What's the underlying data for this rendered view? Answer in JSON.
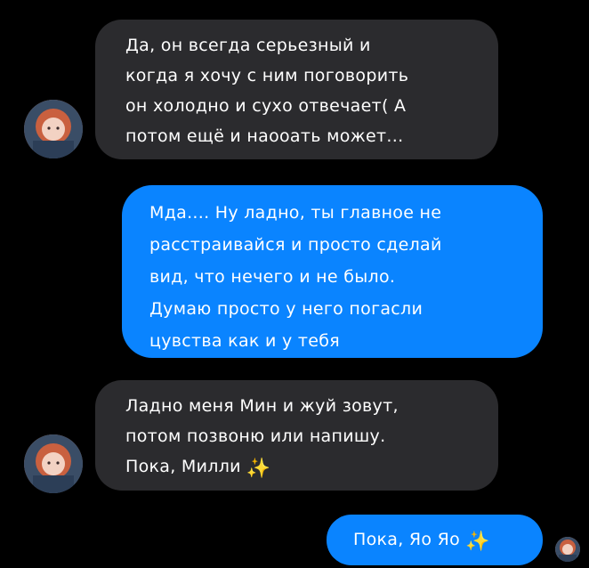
{
  "messages": [
    {
      "id": "msg1",
      "direction": "incoming",
      "lines": [
        "Да, он всегда серьезный и",
        "когда я хочу с ним поговорить",
        "он холодно и сухо отвечает( А",
        "потом ещё и наооать может..."
      ]
    },
    {
      "id": "msg2",
      "direction": "outgoing",
      "lines": [
        "Мда.... Ну ладно, ты главное не",
        "расстраивайся и просто сделай",
        "вид, что нечего и не было.",
        "Думаю просто у него погасли",
        "цувства как и у тебя"
      ]
    },
    {
      "id": "msg3",
      "direction": "incoming",
      "lines": [
        "Ладно меня Мин и жуй зовут,",
        "потом позвоню или напишу.",
        "Пока, Милли"
      ],
      "emoji": "✨"
    },
    {
      "id": "msg4",
      "direction": "outgoing",
      "lines": [
        "Пока, Яо Яо"
      ],
      "emoji": "✨"
    }
  ],
  "colors": {
    "background": "#000000",
    "incoming_bubble": "#2b2b2e",
    "outgoing_bubble": "#0a84ff",
    "text": "#ffffff"
  },
  "icons": {
    "sparkle": "sparkles-emoji",
    "avatar": "contact-avatar"
  }
}
